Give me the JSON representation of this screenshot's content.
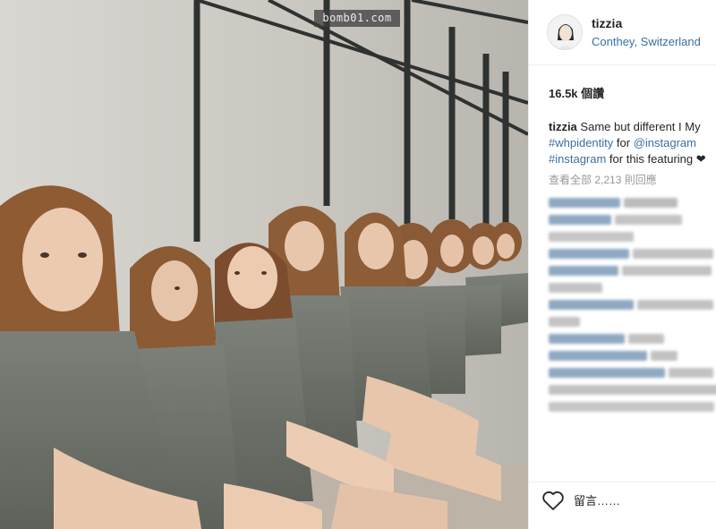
{
  "watermark": "bomb01.com",
  "post": {
    "username": "tizzia",
    "location": "Conthey, Switzerland",
    "views": "16.5k 個讚",
    "caption": {
      "user": "tizzia",
      "text1": "Same but different I My",
      "tag1": "#whpidentity",
      "text2": " for ",
      "tag2": "@instagram",
      "tag3": "#instagram",
      "text3": " for this featuring ❤"
    },
    "view_all": "查看全部 2,213 則回應",
    "comment_placeholder": "留言……"
  },
  "icons": {
    "avatar": "avatar-icon",
    "like": "heart-icon"
  },
  "colors": {
    "link": "#3b6fa0",
    "blur_text": "#8fa9c2"
  }
}
